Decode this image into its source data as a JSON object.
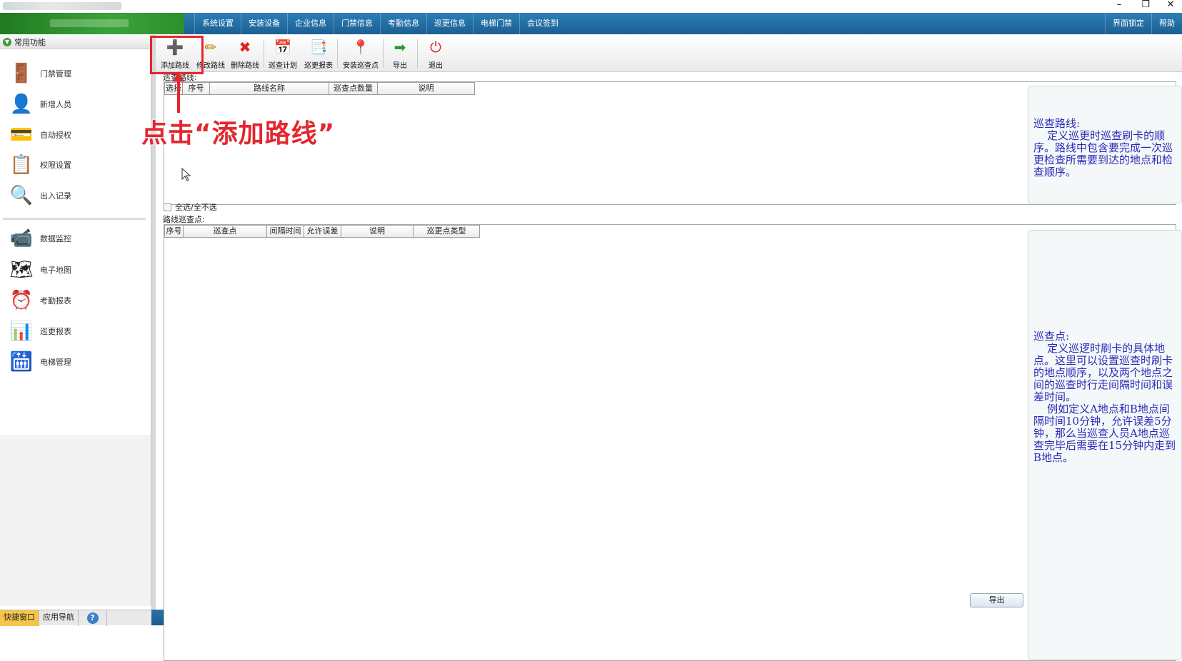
{
  "window": {
    "minimize": "–",
    "restore": "❐",
    "close": "✕"
  },
  "menubar": {
    "items": [
      "系统设置",
      "安装设备",
      "企业信息",
      "门禁信息",
      "考勤信息",
      "巡更信息",
      "电梯门禁",
      "会议签到"
    ],
    "right_items": [
      "界面锁定",
      "帮助"
    ]
  },
  "sidebar": {
    "header": "常用功能",
    "group1": [
      {
        "label": "门禁管理",
        "icon": "🚪"
      },
      {
        "label": "新增人员",
        "icon": "👤"
      },
      {
        "label": "自动授权",
        "icon": "💳"
      },
      {
        "label": "权限设置",
        "icon": "📋"
      },
      {
        "label": "出入记录",
        "icon": "🔍"
      }
    ],
    "group2": [
      {
        "label": "数据监控",
        "icon": "📹"
      },
      {
        "label": "电子地图",
        "icon": "🗺"
      },
      {
        "label": "考勤报表",
        "icon": "⏰"
      },
      {
        "label": "巡更报表",
        "icon": "📊"
      },
      {
        "label": "电梯管理",
        "icon": "🛗"
      }
    ]
  },
  "bottom_tabs": {
    "quick": "快捷窗口",
    "nav": "应用导航",
    "help": "?"
  },
  "toolbar": [
    {
      "label": "添加路线",
      "icon": "➕",
      "color": "#2a9a2a"
    },
    {
      "label": "修改路线",
      "icon": "✏",
      "color": "#c07a00"
    },
    {
      "label": "删除路线",
      "icon": "✖",
      "color": "#d22"
    },
    {
      "label": "巡查计划",
      "icon": "📅",
      "color": "#4a6fa5"
    },
    {
      "label": "巡更报表",
      "icon": "📑",
      "color": "#4a6fa5"
    },
    {
      "label": "安装巡查点",
      "icon": "📍",
      "color": "#2a9a2a"
    },
    {
      "label": "导出",
      "icon": "➡",
      "color": "#2a9a2a"
    },
    {
      "label": "退出",
      "icon": "⏻",
      "color": "#d22"
    }
  ],
  "annotation": {
    "text": "点击“添加路线”",
    "color": "#e3272f"
  },
  "routes": {
    "label": "巡查路线:",
    "columns": [
      "选择",
      "序号",
      "路线名称",
      "巡查点数量",
      "说明"
    ]
  },
  "select_all": "全选/全不选",
  "points": {
    "label": "路线巡查点:",
    "columns": [
      "序号",
      "巡查点",
      "间隔时间",
      "允许误差",
      "说明",
      "巡更点类型"
    ]
  },
  "info_routes": "巡查路线:\n    定义巡更时巡查刷卡的顺序。路线中包含要完成一次巡更检查所需要到达的地点和检查顺序。",
  "info_points": "巡查点:\n    定义巡逻时刷卡的具体地点。这里可以设置巡查时刷卡的地点顺序，以及两个地点之间的巡查时行走间隔时间和误差时间。\n    例如定义A地点和B地点间隔时间10分钟，允许误差5分钟，那么当巡查人员A地点巡查完毕后需要在15分钟内走到B地点。",
  "export_button": "导出"
}
